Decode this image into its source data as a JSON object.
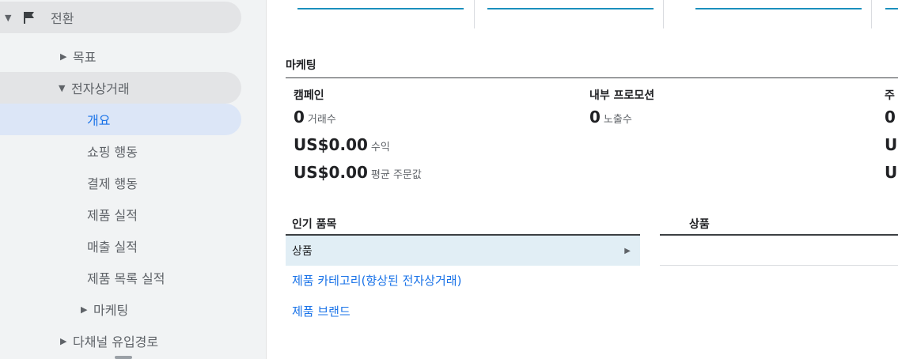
{
  "sidebar": {
    "items": [
      {
        "label": "전환"
      },
      {
        "label": "목표"
      },
      {
        "label": "전자상거래"
      },
      {
        "label": "개요"
      },
      {
        "label": "쇼핑 행동"
      },
      {
        "label": "결제 행동"
      },
      {
        "label": "제품 실적"
      },
      {
        "label": "매출 실적"
      },
      {
        "label": "제품 목록 실적"
      },
      {
        "label": "마케팅"
      },
      {
        "label": "다채널 유입경로"
      }
    ]
  },
  "marketing": {
    "title": "마케팅",
    "columns": [
      {
        "header": "캠페인",
        "metrics": [
          {
            "value": "0",
            "label": "거래수"
          },
          {
            "value": "US$0.00",
            "label": "수익"
          },
          {
            "value": "US$0.00",
            "label": "평균 주문값"
          }
        ]
      },
      {
        "header": "내부 프로모션",
        "metrics": [
          {
            "value": "0",
            "label": "노출수"
          }
        ]
      },
      {
        "header": "주",
        "metrics": [
          {
            "value": "0"
          },
          {
            "value": "U"
          },
          {
            "value": "U"
          }
        ]
      }
    ]
  },
  "popular": {
    "title": "인기 품목",
    "selected": "상품",
    "links": [
      "제품 카테고리(향상된 전자상거래)",
      "제품 브랜드"
    ]
  },
  "product_panel": {
    "title": "상품"
  },
  "colors": {
    "accent": "#1a73e8",
    "rule": "#1a8fbd",
    "sidebar_bg": "#f1f3f4",
    "active_bg": "#dce6f7"
  }
}
